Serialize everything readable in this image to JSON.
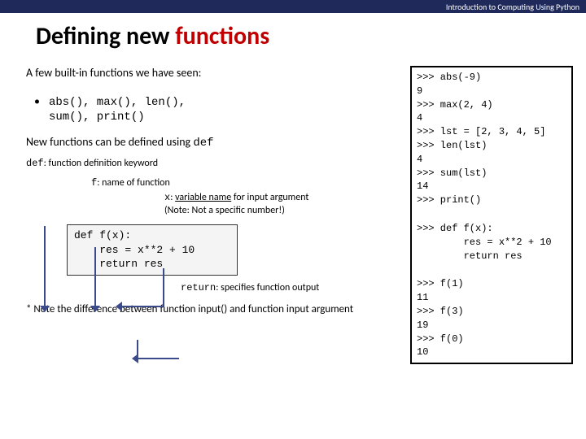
{
  "header": {
    "course": "Introduction to Computing Using Python"
  },
  "title": {
    "part1": "Defining new ",
    "part2": "functions"
  },
  "left": {
    "intro": "A few built-in functions we have seen:",
    "bullet_line1": "abs(), max(), len(),",
    "bullet_line2": "sum(), print()",
    "newfuncs_pre": "New functions can be defined using ",
    "newfuncs_kw": "def",
    "def_kw": "def",
    "def_kw_post": ": function definition keyword",
    "anno_f_kw": "f",
    "anno_f_post": ": name of function",
    "anno_x_kw": "x",
    "anno_x_u": "variable name",
    "anno_x_post2": " for input argument",
    "anno_x_note": "(Note: Not a specific number!)",
    "code_l1": "def f(x):",
    "code_l2": "    res = x**2 + 10",
    "code_l3": "    return res",
    "anno_return_kw": "return",
    "anno_return_post": ": specifies function output",
    "note": "* Note the difference between function input() and function input argument"
  },
  "terminal": {
    "block1": ">>> abs(-9)\n9\n>>> max(2, 4)\n4\n>>> lst = [2, 3, 4, 5]\n>>> len(lst)\n4\n>>> sum(lst)\n14\n>>> print()",
    "block2": ">>> def f(x):\n        res = x**2 + 10\n        return res",
    "block3": ">>> f(1)\n11\n>>> f(3)\n19\n>>> f(0)\n10"
  }
}
